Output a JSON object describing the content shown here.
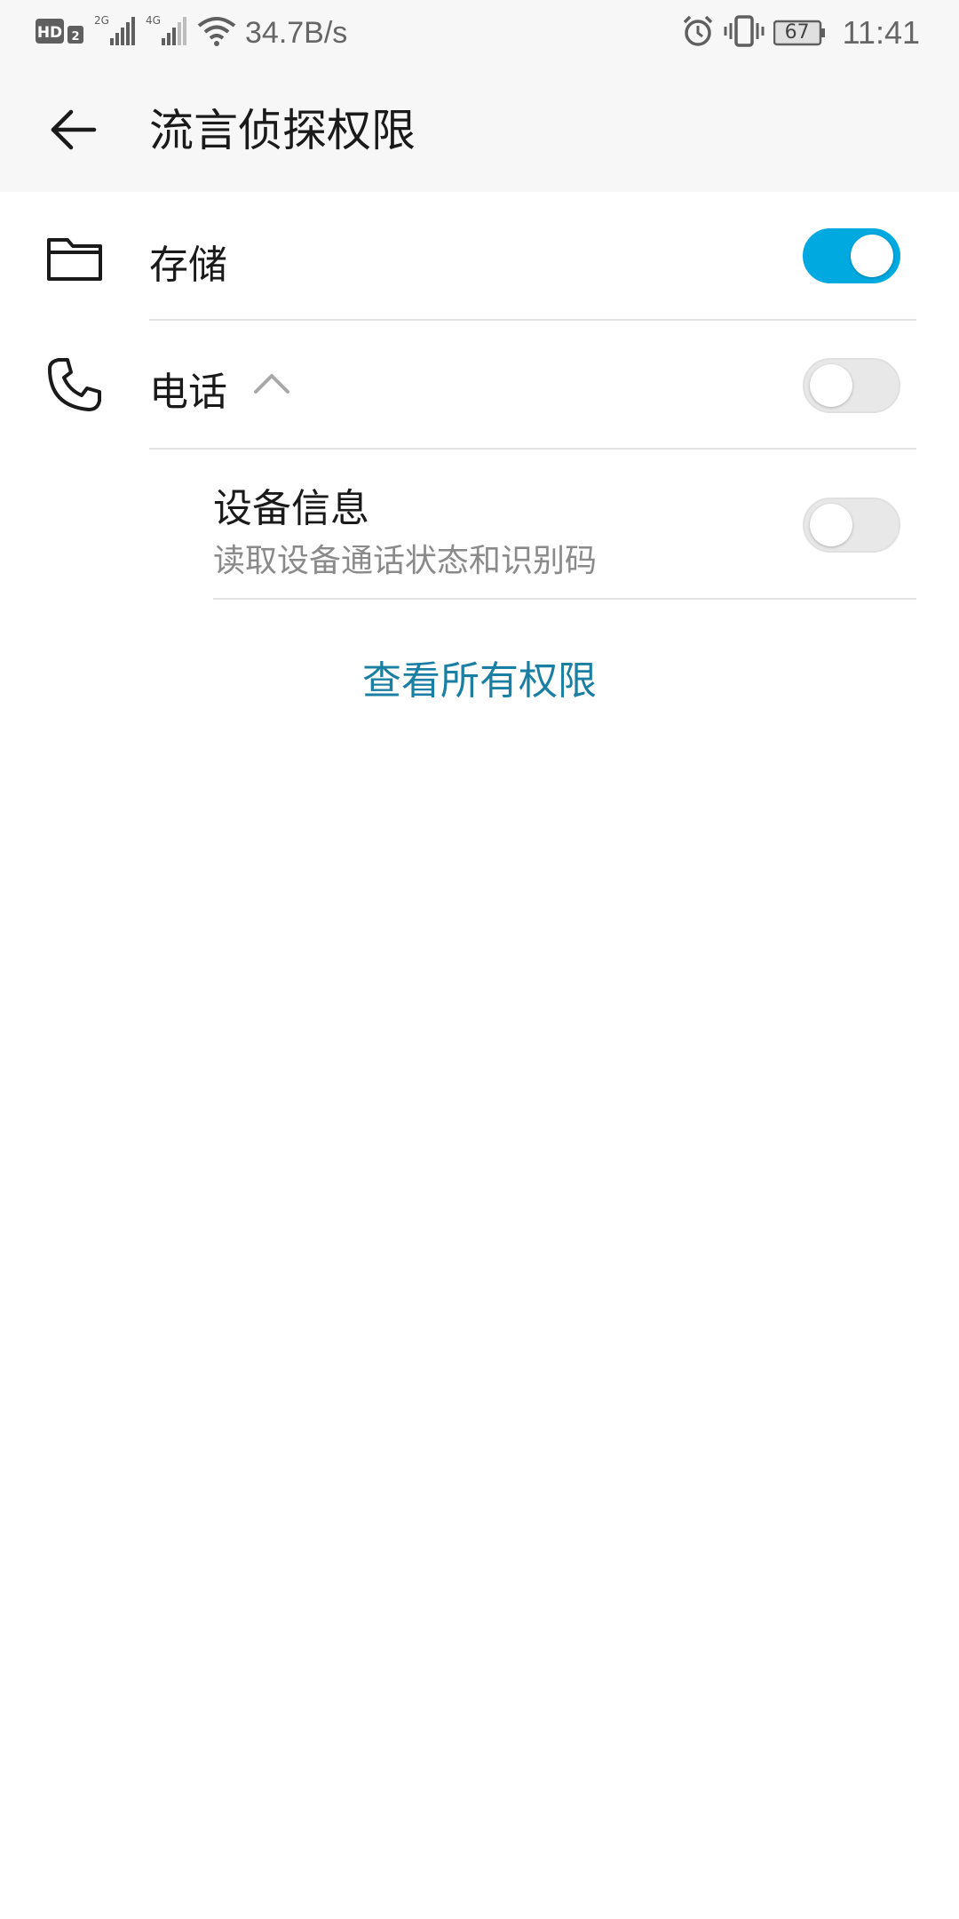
{
  "status_bar": {
    "network_speed": "34.7B/s",
    "battery_level": "67",
    "time": "11:41",
    "hd_badge": "HD",
    "sim_slot": "2",
    "net_2g": "2G",
    "net_4g": "4G",
    "icons": [
      "hd-icon",
      "signal-2g-icon",
      "signal-4g-icon",
      "wifi-icon",
      "alarm-icon",
      "vibrate-icon",
      "battery-icon"
    ]
  },
  "header": {
    "title": "流言侦探权限",
    "back_icon": "arrow-left-icon"
  },
  "permissions": [
    {
      "label": "存储",
      "icon": "folder-icon",
      "enabled": true
    },
    {
      "label": "电话",
      "icon": "phone-icon",
      "enabled": false,
      "expanded": true,
      "children": [
        {
          "title": "设备信息",
          "description": "读取设备通话状态和识别码",
          "enabled": false
        }
      ]
    }
  ],
  "footer": {
    "view_all_label": "查看所有权限"
  },
  "colors": {
    "accent": "#00a9e0",
    "link": "#1a7fa2",
    "toggle_off": "#e8e8e8"
  }
}
